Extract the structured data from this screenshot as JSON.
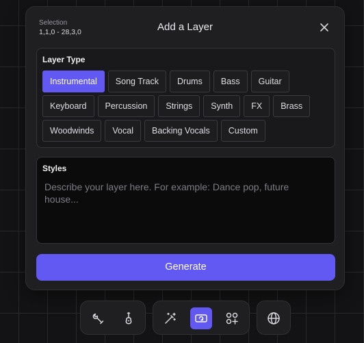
{
  "dialog": {
    "selection_label": "Selection",
    "selection_value": "1,1,0 - 28,3,0",
    "title": "Add a Layer",
    "close_icon": "close-icon"
  },
  "layer_type": {
    "heading": "Layer Type",
    "selected": "Instrumental",
    "rows": [
      [
        "Instrumental",
        "Song Track",
        "Drums",
        "Bass",
        "Guitar"
      ],
      [
        "Keyboard",
        "Percussion",
        "Strings",
        "Synth",
        "FX",
        "Brass"
      ],
      [
        "Woodwinds",
        "Vocal",
        "Backing Vocals",
        "Custom"
      ]
    ]
  },
  "styles": {
    "heading": "Styles",
    "placeholder": "Describe your layer here. For example: Dance pop, future house..."
  },
  "generate_label": "Generate",
  "toolbar": {
    "groups": [
      [
        "wrench-icon",
        "guitar-icon"
      ],
      [
        "magic-wand-icon",
        "loop-icon",
        "add-grid-icon"
      ],
      [
        "globe-icon"
      ]
    ],
    "active": "loop-icon"
  },
  "colors": {
    "accent": "#6259f2",
    "dialog_bg": "#1f1f22",
    "page_bg": "#131315"
  }
}
